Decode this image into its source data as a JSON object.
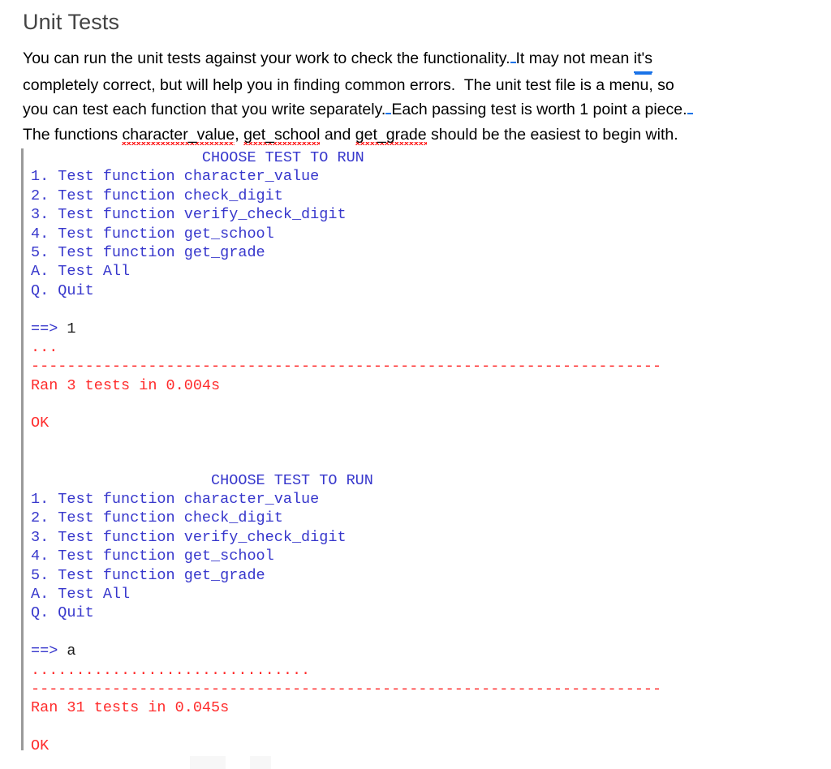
{
  "document": {
    "title": "Unit Tests",
    "paragraph": {
      "seg1": "You can run the unit tests against your work to check the functionality.",
      "seg2": "It may not mean ",
      "seg3": "it's",
      "seg4": "\ncompletely correct, but will help you in finding common errors.  The unit test file is a menu, so\nyou can test each function that you write separately.",
      "seg5": "Each passing test is worth 1 point a piece.",
      "seg6": "\nThe functions ",
      "spell1": "character_value",
      "seg7": ", ",
      "spell2": "get_school",
      "seg8": " and ",
      "spell3": "get_grade",
      "seg9": " should be the easiest to begin with."
    }
  },
  "terminal": {
    "menu_header": "                   CHOOSE TEST TO RUN",
    "menu_header_2": "                    CHOOSE TEST TO RUN",
    "menu_items": [
      "1. Test function character_value",
      "2. Test function check_digit",
      "3. Test function verify_check_digit",
      "4. Test function get_school",
      "5. Test function get_grade",
      "A. Test All",
      "Q. Quit"
    ],
    "run1": {
      "prompt": "==> ",
      "input": "1",
      "dots": "...",
      "separator": "----------------------------------------------------------------------",
      "summary": "Ran 3 tests in 0.004s",
      "result": "OK"
    },
    "run2": {
      "prompt": "==> ",
      "input": "a",
      "dots": "...............................",
      "separator": "----------------------------------------------------------------------",
      "summary": "Ran 31 tests in 0.045s",
      "result": "OK"
    }
  },
  "colors": {
    "terminal_blue": "#3737cc",
    "terminal_red": "#ff2b2b",
    "heading_gray": "#434343",
    "grammar_blue": "#1a73e8",
    "spelling_red": "#ff0000",
    "gutter_gray": "#9a9a9a"
  }
}
